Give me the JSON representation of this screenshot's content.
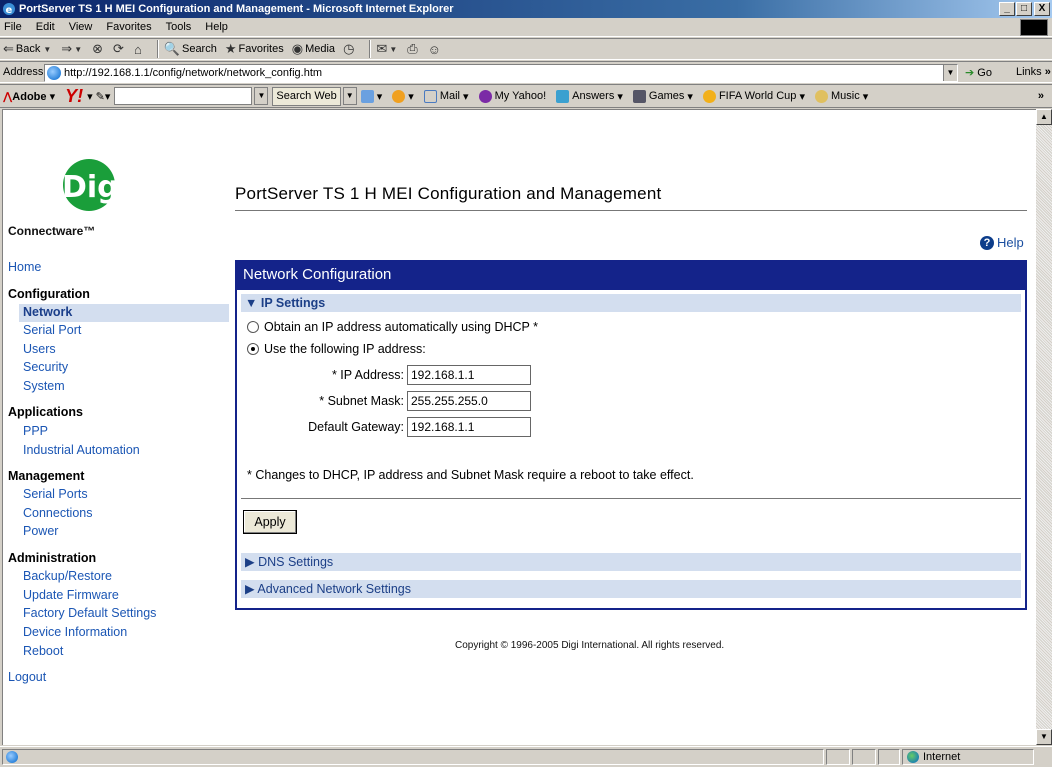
{
  "window": {
    "title": "PortServer TS 1 H MEI Configuration and Management - Microsoft Internet Explorer",
    "min": "_",
    "max": "□",
    "close": "X"
  },
  "menu": [
    "File",
    "Edit",
    "View",
    "Favorites",
    "Tools",
    "Help"
  ],
  "toolbar": {
    "back": "Back",
    "search": "Search",
    "favorites": "Favorites",
    "media": "Media"
  },
  "address": {
    "label": "Address",
    "url": "http://192.168.1.1/config/network/network_config.htm",
    "go": "Go",
    "links": "Links"
  },
  "linksbar": {
    "adobe": "Adobe",
    "search_web": "Search Web",
    "items": [
      "Mail",
      "My Yahoo!",
      "Answers",
      "Games",
      "FIFA World Cup",
      "Music"
    ]
  },
  "page": {
    "brand": "Connectware™",
    "logo_text": "Digi",
    "title": "PortServer TS 1 H MEI Configuration and Management",
    "help": "Help",
    "copyright": "Copyright © 1996-2005 Digi International. All rights reserved."
  },
  "nav": {
    "home": "Home",
    "config": "Configuration",
    "config_items": [
      "Network",
      "Serial Port",
      "Users",
      "Security",
      "System"
    ],
    "apps": "Applications",
    "apps_items": [
      "PPP",
      "Industrial Automation"
    ],
    "mgmt": "Management",
    "mgmt_items": [
      "Serial Ports",
      "Connections",
      "Power"
    ],
    "admin": "Administration",
    "admin_items": [
      "Backup/Restore",
      "Update Firmware",
      "Factory Default Settings",
      "Device Information",
      "Reboot"
    ],
    "logout": "Logout"
  },
  "panel": {
    "title": "Network Configuration",
    "ip_settings": "IP Settings",
    "dhcp_option": "Obtain an IP address automatically using DHCP *",
    "static_option": "Use the following IP address:",
    "ip_label": "* IP Address:",
    "ip_value": "192.168.1.1",
    "mask_label": "* Subnet Mask:",
    "mask_value": "255.255.255.0",
    "gw_label": "Default Gateway:",
    "gw_value": "192.168.1.1",
    "note": "* Changes to DHCP, IP address and Subnet Mask require a reboot to take effect.",
    "apply": "Apply",
    "dns": "DNS Settings",
    "advanced": "Advanced Network Settings"
  },
  "status": {
    "zone": "Internet"
  }
}
